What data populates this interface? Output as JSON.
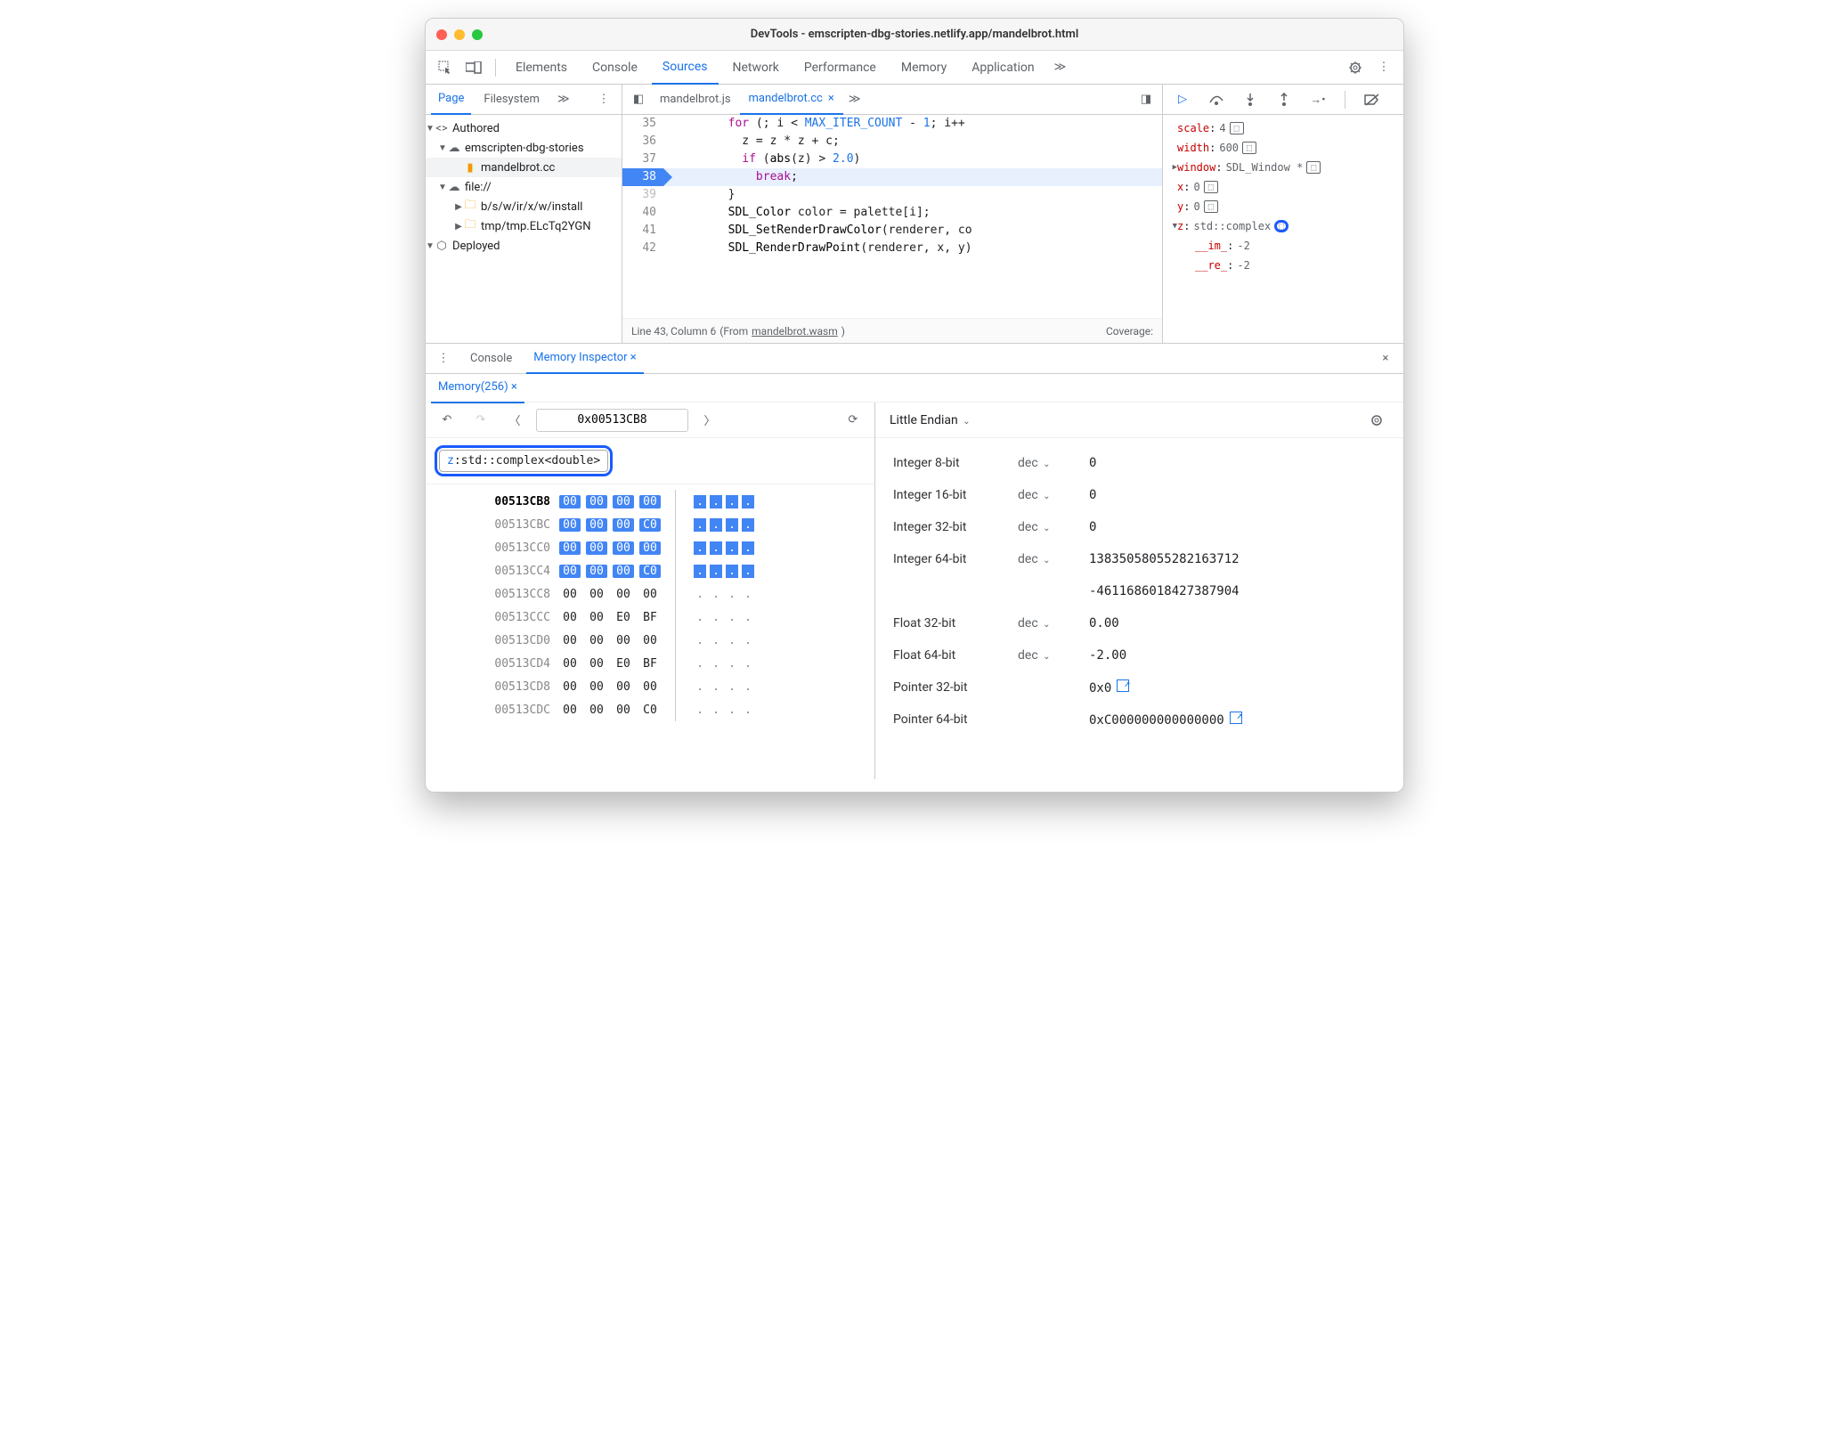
{
  "window_title": "DevTools - emscripten-dbg-stories.netlify.app/mandelbrot.html",
  "topbar": {
    "tabs": [
      "Elements",
      "Console",
      "Sources",
      "Network",
      "Performance",
      "Memory",
      "Application"
    ],
    "active": "Sources"
  },
  "sidebar": {
    "tabs": [
      "Page",
      "Filesystem"
    ],
    "tree": {
      "authored": "Authored",
      "project": "emscripten-dbg-stories",
      "file1": "mandelbrot.cc",
      "filegroup": "file://",
      "folder1": "b/s/w/ir/x/w/install",
      "folder2": "tmp/tmp.ELcTq2YGN",
      "deployed": "Deployed"
    }
  },
  "editor": {
    "tabs": [
      "mandelbrot.js",
      "mandelbrot.cc"
    ],
    "active": "mandelbrot.cc",
    "lines": [
      {
        "n": 35,
        "t": "        for (; i < MAX_ITER_COUNT - 1; i++"
      },
      {
        "n": 36,
        "t": "          z = z * z + c;"
      },
      {
        "n": 37,
        "t": "          if (abs(z) > 2.0)"
      },
      {
        "n": 38,
        "t": "            break;",
        "hl": true
      },
      {
        "n": 39,
        "t": "        }",
        "dim": true
      },
      {
        "n": 40,
        "t": "        SDL_Color color = palette[i];"
      },
      {
        "n": 41,
        "t": "        SDL_SetRenderDrawColor(renderer, co"
      },
      {
        "n": 42,
        "t": "        SDL_RenderDrawPoint(renderer, x, y)"
      }
    ],
    "status": {
      "pos": "Line 43, Column 6",
      "from_label": "(From ",
      "from_link": "mandelbrot.wasm",
      "from_close": ")",
      "coverage": "Coverage:"
    }
  },
  "scope": [
    {
      "k": "scale",
      "v": "4",
      "mem": true
    },
    {
      "k": "width",
      "v": "600",
      "mem": true
    },
    {
      "k": "window",
      "v": "SDL_Window *",
      "mem": true,
      "arrow": true
    },
    {
      "k": "x",
      "v": "0",
      "mem": true
    },
    {
      "k": "y",
      "v": "0",
      "mem": true
    },
    {
      "k": "z",
      "v": "std::complex<double>",
      "mem": true,
      "open": true,
      "circled": true
    },
    {
      "k": "__im_",
      "v": "-2",
      "sub": true
    },
    {
      "k": "__re_",
      "v": "-2",
      "sub": true
    }
  ],
  "drawer": {
    "tabs": [
      "Console",
      "Memory Inspector"
    ],
    "subtab": "Memory(256)",
    "address": "0x00513CB8",
    "chip": {
      "k": "z",
      "t": "std::complex<double>"
    },
    "hex": [
      {
        "a": "00513CB8",
        "bold": true,
        "b": [
          "00",
          "00",
          "00",
          "00"
        ],
        "hl": true,
        "asc": [
          ".",
          ".",
          ".",
          "."
        ]
      },
      {
        "a": "00513CBC",
        "b": [
          "00",
          "00",
          "00",
          "C0"
        ],
        "hl": true,
        "asc": [
          ".",
          ".",
          ".",
          "."
        ]
      },
      {
        "a": "00513CC0",
        "b": [
          "00",
          "00",
          "00",
          "00"
        ],
        "hl": true,
        "asc": [
          ".",
          ".",
          ".",
          "."
        ]
      },
      {
        "a": "00513CC4",
        "b": [
          "00",
          "00",
          "00",
          "C0"
        ],
        "hl": true,
        "asc": [
          ".",
          ".",
          ".",
          "."
        ]
      },
      {
        "a": "00513CC8",
        "b": [
          "00",
          "00",
          "00",
          "00"
        ],
        "asc": [
          ".",
          ".",
          ".",
          "."
        ]
      },
      {
        "a": "00513CCC",
        "b": [
          "00",
          "00",
          "E0",
          "BF"
        ],
        "asc": [
          ".",
          ".",
          ".",
          "."
        ]
      },
      {
        "a": "00513CD0",
        "b": [
          "00",
          "00",
          "00",
          "00"
        ],
        "asc": [
          ".",
          ".",
          ".",
          "."
        ]
      },
      {
        "a": "00513CD4",
        "b": [
          "00",
          "00",
          "E0",
          "BF"
        ],
        "asc": [
          ".",
          ".",
          ".",
          "."
        ]
      },
      {
        "a": "00513CD8",
        "b": [
          "00",
          "00",
          "00",
          "00"
        ],
        "asc": [
          ".",
          ".",
          ".",
          "."
        ]
      },
      {
        "a": "00513CDC",
        "b": [
          "00",
          "00",
          "00",
          "C0"
        ],
        "asc": [
          ".",
          ".",
          ".",
          "."
        ]
      }
    ],
    "endian": "Little Endian",
    "values": [
      {
        "l": "Integer 8-bit",
        "e": "dec",
        "v": "0"
      },
      {
        "l": "Integer 16-bit",
        "e": "dec",
        "v": "0"
      },
      {
        "l": "Integer 32-bit",
        "e": "dec",
        "v": "0"
      },
      {
        "l": "Integer 64-bit",
        "e": "dec",
        "v": "13835058055282163712"
      },
      {
        "l": "",
        "e": "",
        "v": "-4611686018427387904"
      },
      {
        "l": "Float 32-bit",
        "e": "dec",
        "v": "0.00"
      },
      {
        "l": "Float 64-bit",
        "e": "dec",
        "v": "-2.00"
      },
      {
        "l": "Pointer 32-bit",
        "e": "",
        "v": "0x0",
        "link": true
      },
      {
        "l": "Pointer 64-bit",
        "e": "",
        "v": "0xC000000000000000",
        "link": true
      }
    ]
  }
}
